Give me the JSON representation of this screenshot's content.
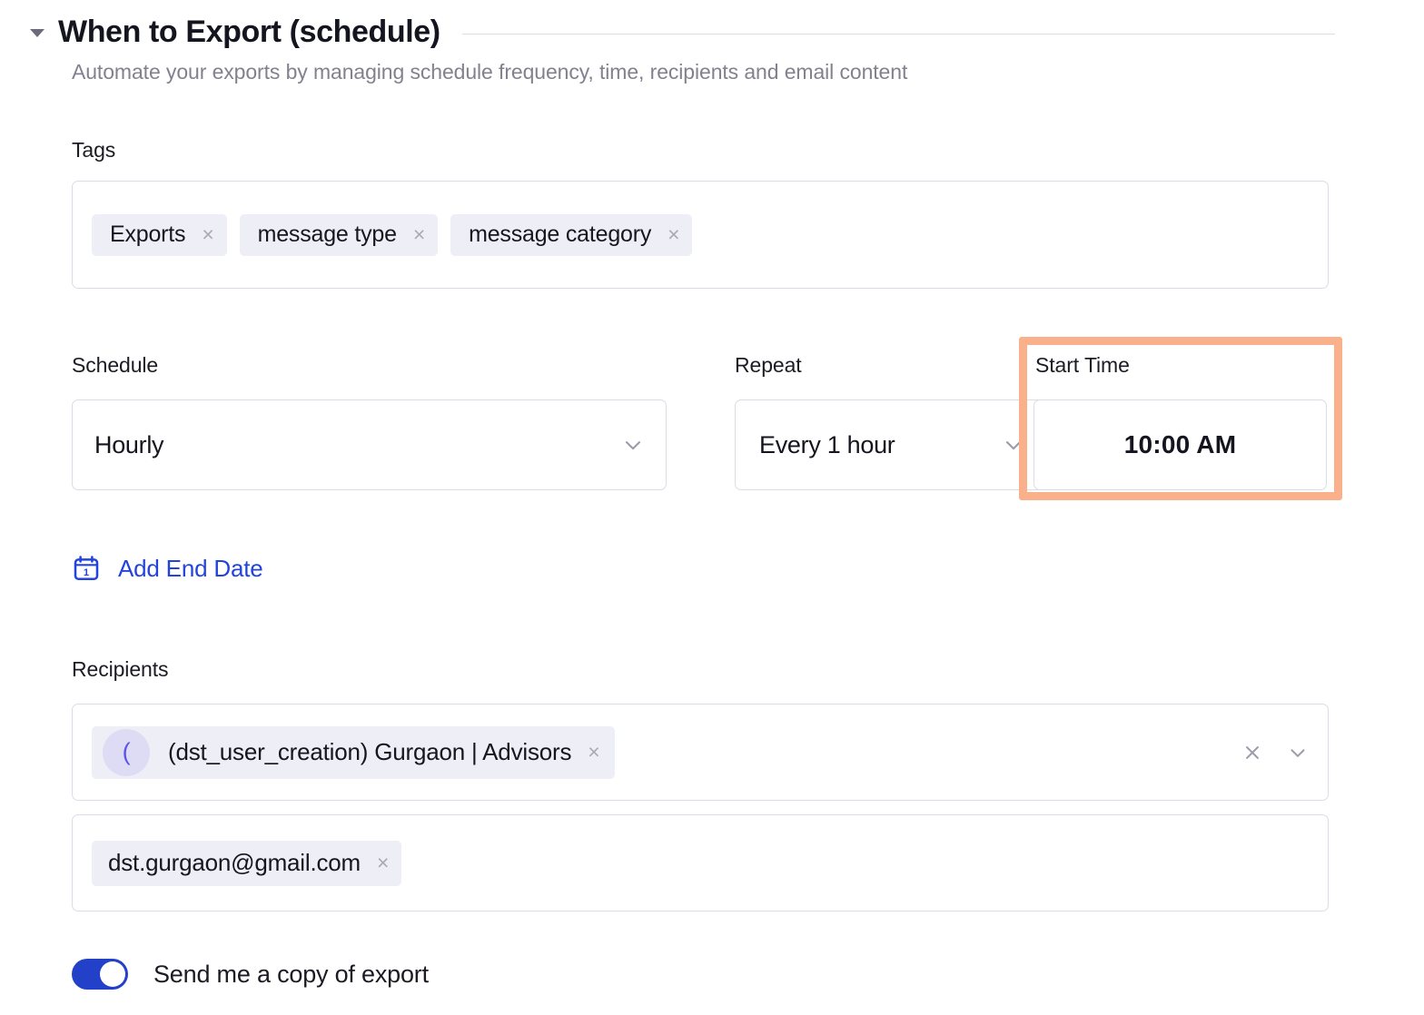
{
  "section": {
    "title": "When to Export (schedule)",
    "subtitle": "Automate your exports by managing schedule frequency, time, recipients and email content",
    "collapse_icon": "caret-down-icon",
    "expanded": true
  },
  "tags": {
    "label": "Tags",
    "items": [
      {
        "text": "Exports",
        "remove": "×"
      },
      {
        "text": "message type",
        "remove": "×"
      },
      {
        "text": "message category",
        "remove": "×"
      }
    ]
  },
  "schedule": {
    "label": "Schedule",
    "value": "Hourly",
    "chevron_icon": "chevron-down-icon"
  },
  "repeat": {
    "label": "Repeat",
    "value": "Every 1 hour",
    "chevron_icon": "chevron-down-icon"
  },
  "start_time": {
    "label": "Start Time",
    "value": "10:00 AM",
    "highlight_color": "#f9b08b",
    "highlighted": true
  },
  "add_end_date": {
    "label": "Add End Date",
    "icon": "calendar-icon",
    "icon_day_number": "1",
    "link_color": "#2244dd"
  },
  "recipients": {
    "label": "Recipients",
    "selected": {
      "avatar_initial": "(",
      "text": "(dst_user_creation) Gurgaon | Advisors",
      "remove": "×"
    },
    "clear_icon": "close-icon",
    "dropdown_icon": "chevron-down-icon"
  },
  "emails": {
    "items": [
      {
        "text": "dst.gurgaon@gmail.com",
        "remove": "×"
      }
    ]
  },
  "send_copy": {
    "label": "Send me a copy of export",
    "enabled": true,
    "on_color": "#2240c8"
  }
}
